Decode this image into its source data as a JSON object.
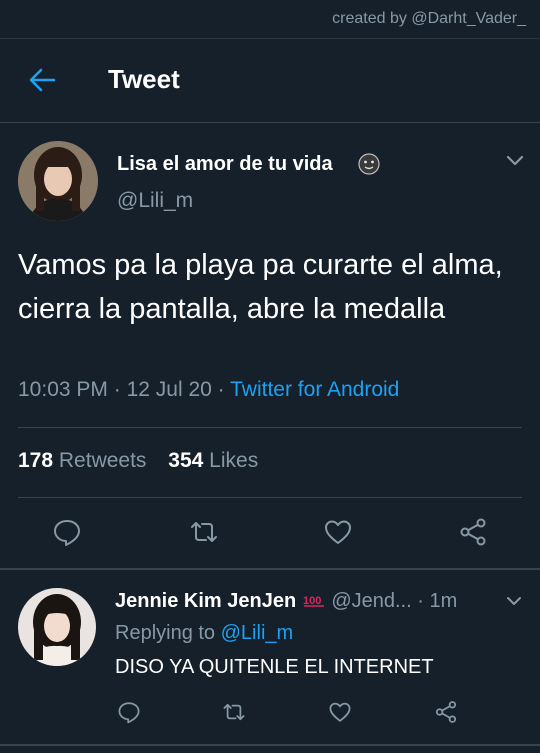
{
  "watermark": "created by @Darht_Vader_",
  "header": {
    "title": "Tweet"
  },
  "tweet": {
    "author_name": "Lisa el amor de tu vida",
    "author_handle": "@Lili_m",
    "text": "Vamos pa la playa pa curarte el alma, cierra la pantalla, abre la medalla",
    "time": "10:03 PM",
    "separator": "·",
    "date": "12 Jul 20",
    "source": "Twitter for Android",
    "retweets_count": "178",
    "retweets_label": "Retweets",
    "likes_count": "354",
    "likes_label": "Likes"
  },
  "reply": {
    "author_name": "Jennie Kim JenJen",
    "badge_icon": "hundred-points-icon",
    "author_handle": "@Jend...",
    "separator": "·",
    "time": "1m",
    "replying_prefix": "Replying to",
    "replying_to": "@Lili_m",
    "text": "DISO YA QUITENLE EL INTERNET"
  },
  "colors": {
    "background": "#15202b",
    "accent": "#1da1f2",
    "secondary_text": "#8899a6",
    "divider": "#38444d"
  }
}
